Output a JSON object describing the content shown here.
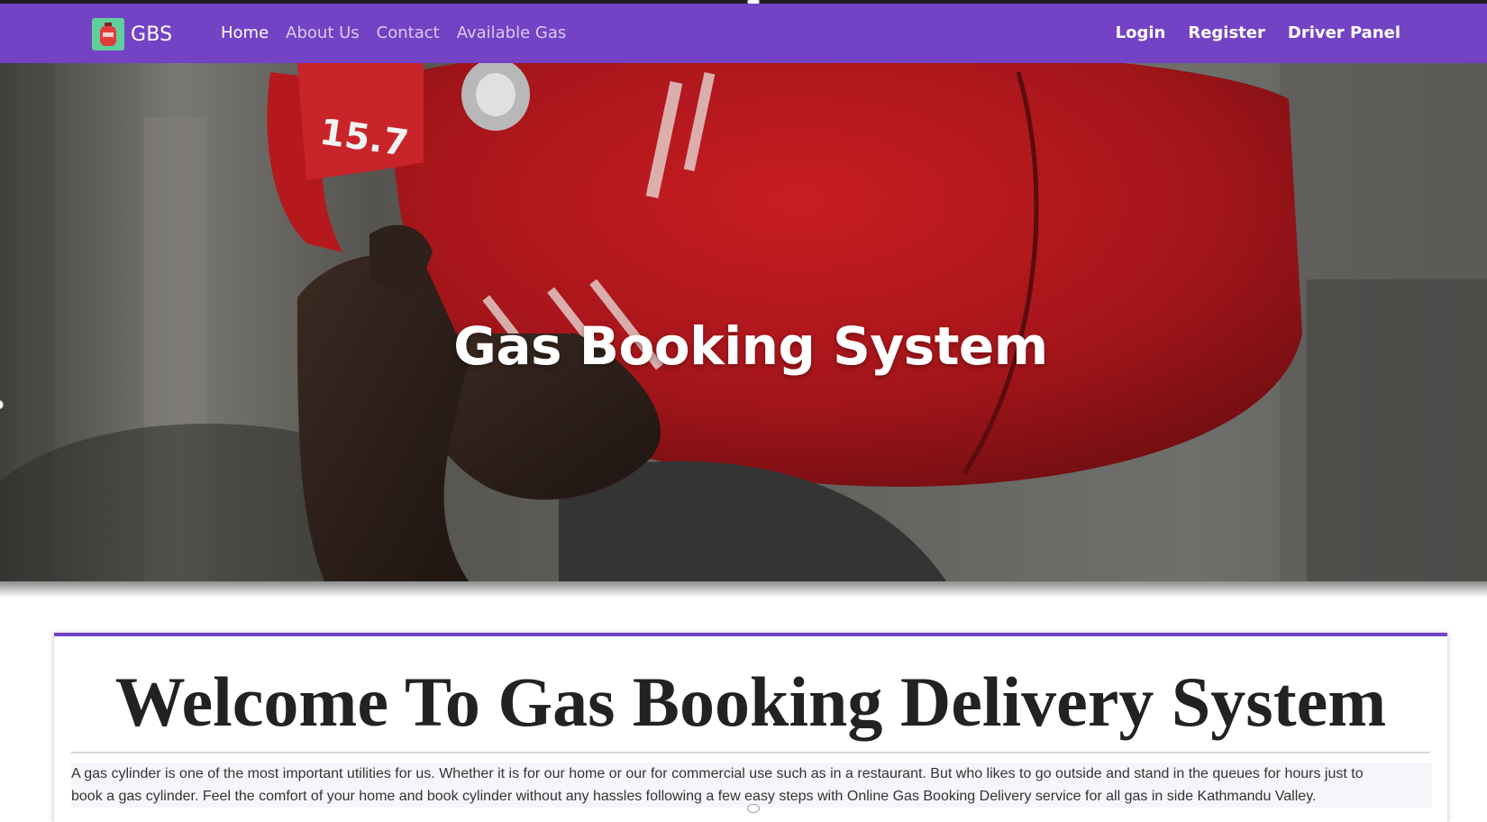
{
  "brand": {
    "name": "GBS",
    "logo_icon": "gas-cylinder-icon",
    "logo_color": "#5fcf9c"
  },
  "nav": {
    "left_items": [
      {
        "label": "Home",
        "active": true
      },
      {
        "label": "About Us",
        "active": false
      },
      {
        "label": "Contact",
        "active": false
      },
      {
        "label": "Available Gas",
        "active": false
      }
    ],
    "right_items": [
      {
        "label": "Login"
      },
      {
        "label": "Register"
      },
      {
        "label": "Driver Panel"
      }
    ]
  },
  "hero": {
    "title": "Gas Booking System",
    "image_description_icon": "man-carrying-gas-cylinder-photo"
  },
  "welcome": {
    "heading": "Welcome To Gas Booking Delivery System",
    "paragraph_line1": "A gas cylinder is one of the most important utilities for us. Whether it is for our home or our for commercial use such as in a restaurant. But who likes to go outside and stand in the queues for hours just to",
    "paragraph_line2": "book a gas cylinder. Feel the comfort of your home and book cylinder without any hassles following a few easy steps with Online Gas Booking Delivery service for all gas in side Kathmandu Valley."
  },
  "colors": {
    "navbar": "#7442c4",
    "accent": "#7442c4",
    "cylinder_red": "#b4141a"
  }
}
